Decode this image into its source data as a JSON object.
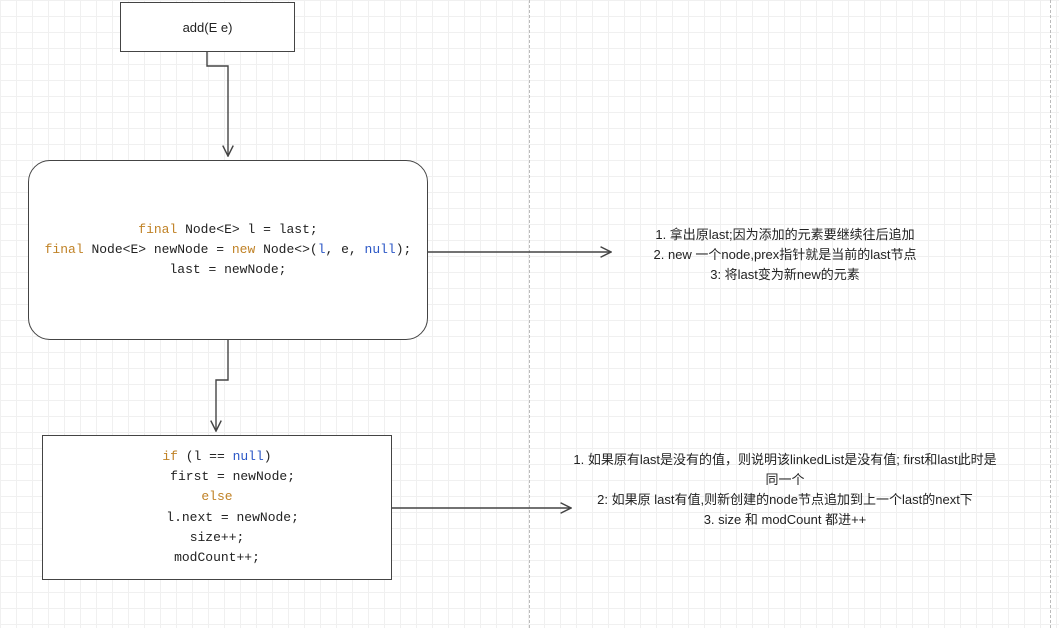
{
  "node_start": {
    "label": "add(E e)"
  },
  "node_process": {
    "code_html": "<span class=\"kw\">final</span> Node&lt;E&gt; l = last;<br><span class=\"kw\">final</span> Node&lt;E&gt; newNode = <span class=\"kw\">new</span> Node&lt;&gt;(<span class=\"lit\">l</span>, e, <span class=\"null\">null</span>);<br>last = newNode;"
  },
  "node_branch": {
    "code_html": "<span class=\"kw\">if</span> (l == <span class=\"null\">null</span>)<br>    first = newNode;<br><span class=\"kw\">else</span><br>    l.next = newNode;<br>size++;<br>modCount++;"
  },
  "annot_process": {
    "lines": [
      "1. 拿出原last;因为添加的元素要继续往后追加",
      "2. new 一个node,prex指针就是当前的last节点",
      "3: 将last变为新new的元素"
    ]
  },
  "annot_branch": {
    "lines": [
      "1. 如果原有last是没有的值，则说明该linkedList是没有值; first和last此时是同一个",
      "2: 如果原 last有值,则新创建的node节点追加到上一个last的next下",
      "3. size 和 modCount 都进++"
    ]
  },
  "chart_data": {
    "type": "flowchart",
    "nodes": [
      {
        "id": "start",
        "shape": "rect",
        "label": "add(E e)"
      },
      {
        "id": "process",
        "shape": "rounded-rect",
        "code": "final Node<E> l = last;\nfinal Node<E> newNode = new Node<>(l, e, null);\nlast = newNode;"
      },
      {
        "id": "branch",
        "shape": "rect",
        "code": "if (l == null)\n    first = newNode;\nelse\n    l.next = newNode;\nsize++;\nmodCount++;"
      }
    ],
    "edges": [
      {
        "from": "start",
        "to": "process"
      },
      {
        "from": "process",
        "to": "branch"
      },
      {
        "from": "process",
        "to": "annot_process",
        "kind": "annotation"
      },
      {
        "from": "branch",
        "to": "annot_branch",
        "kind": "annotation"
      }
    ],
    "annotations": {
      "annot_process": [
        "1. 拿出原last;因为添加的元素要继续往后追加",
        "2. new 一个node,prex指针就是当前的last节点",
        "3: 将last变为新new的元素"
      ],
      "annot_branch": [
        "1. 如果原有last是没有的值，则说明该linkedList是没有值; first和last此时是同一个",
        "2: 如果原 last有值,则新创建的node节点追加到上一个last的next下",
        "3. size 和 modCount 都进++"
      ]
    }
  }
}
